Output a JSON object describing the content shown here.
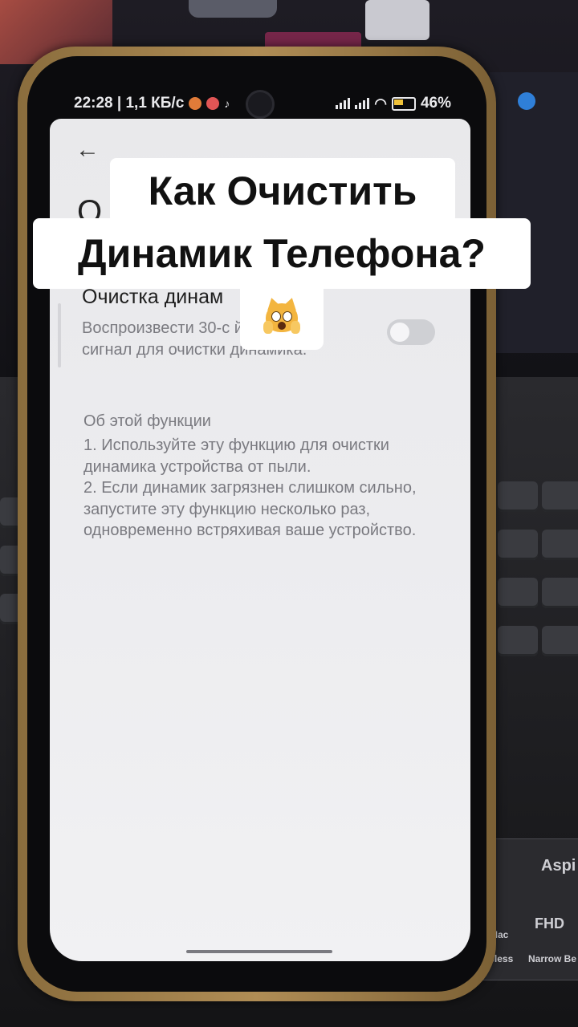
{
  "overlay": {
    "caption_line1": "Как Очистить",
    "caption_line2": "Динамик Телефона?",
    "emoji": "weary-cat-face"
  },
  "status_bar": {
    "time_speed": "22:28 | 1,1 КБ/с",
    "battery": "46"
  },
  "settings": {
    "back_icon": "back-arrow-icon",
    "title_peek": "О",
    "item_title": "Очистка динам",
    "item_desc": "Воспроизвести 30-с          й звуковой сигнал для очистки динамика.",
    "toggle_state": "off"
  },
  "about": {
    "heading": "Об этой функции",
    "line1": "1. Используйте эту функцию для очистки динамика устройства от пыли.",
    "line2": "2. Если динамик загрязнен слишком сильно, запустите эту функцию несколько раз, одновременно встряхивая ваше устройство."
  },
  "background": {
    "brand_text": "Aspi",
    "sticker_line1": "FHD",
    "sticker_line2": "Wireless",
    "sticker_line3": "Narrow Be",
    "sticker_line4": "Mac"
  }
}
